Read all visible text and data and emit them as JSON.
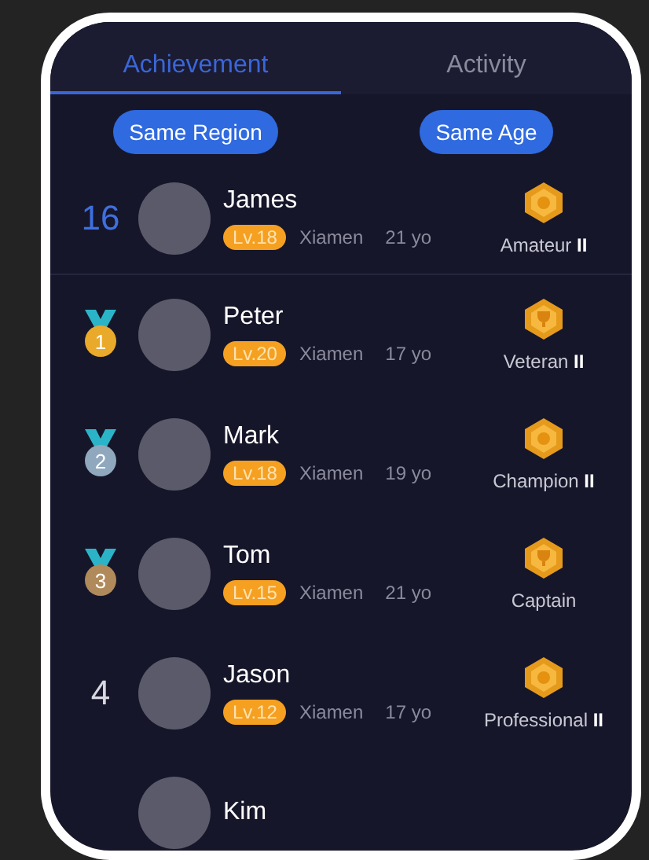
{
  "tabs": [
    {
      "label": "Achievement",
      "selected": true
    },
    {
      "label": "Activity",
      "selected": false
    }
  ],
  "filters": [
    "Same Region",
    "Same Age"
  ],
  "players": [
    {
      "rank": {
        "kind": "number",
        "text": "16",
        "color": "#3f6fe0"
      },
      "name": "James",
      "level": "Lv.18",
      "city": "Xiamen",
      "age": "21 yo",
      "title": "Amateur **II**",
      "self": true
    },
    {
      "rank": {
        "kind": "medal",
        "text": "1",
        "color": "#e9a92a"
      },
      "name": "Peter",
      "level": "Lv.20",
      "city": "Xiamen",
      "age": "17 yo",
      "title": "Veteran **II**",
      "self": false
    },
    {
      "rank": {
        "kind": "medal",
        "text": "2",
        "color": "#8fa8bd"
      },
      "name": "Mark",
      "level": "Lv.18",
      "city": "Xiamen",
      "age": "19 yo",
      "title": "Champion **II**",
      "self": false
    },
    {
      "rank": {
        "kind": "medal",
        "text": "3",
        "color": "#b08a5a"
      },
      "name": "Tom",
      "level": "Lv.15",
      "city": "Xiamen",
      "age": "21 yo",
      "title": "Captain",
      "self": false
    },
    {
      "rank": {
        "kind": "number",
        "text": "4",
        "color": "#d8d8e0"
      },
      "name": "Jason",
      "level": "Lv.12",
      "city": "Xiamen",
      "age": "17 yo",
      "title": "Professional **II**",
      "self": false
    },
    {
      "rank": {
        "kind": "none"
      },
      "name": "Kim",
      "self": false
    }
  ]
}
